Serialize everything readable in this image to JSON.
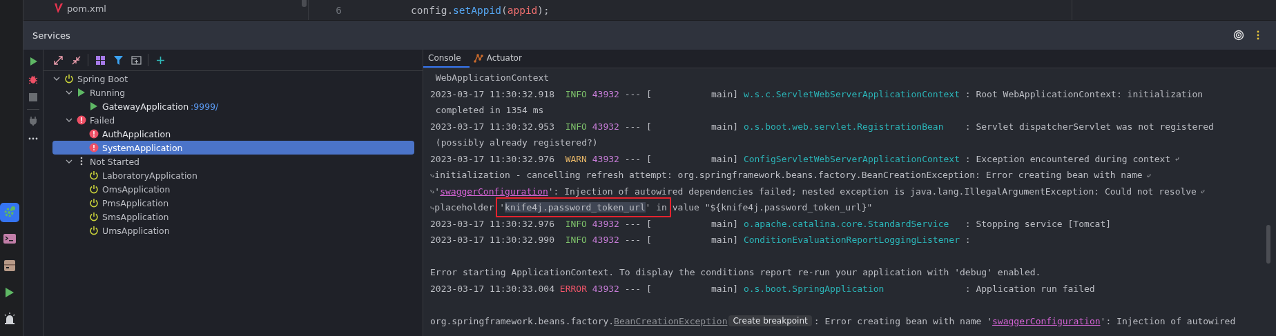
{
  "tool_window_bar": {
    "tools": [
      {
        "selected": true
      },
      {
        "selected": false
      },
      {
        "selected": false
      },
      {
        "selected": false
      },
      {
        "selected": false
      }
    ]
  },
  "project_tree": {
    "items": [
      {
        "label": "pom.xml"
      }
    ]
  },
  "editor": {
    "lines": [
      {
        "number": "6",
        "tokens": [
          {
            "text": "config.",
            "kind": "plain"
          },
          {
            "text": "setAppid",
            "kind": "method"
          },
          {
            "text": "(",
            "kind": "plain"
          },
          {
            "text": "appid",
            "kind": "param"
          },
          {
            "text": ");",
            "kind": "plain"
          }
        ]
      }
    ]
  },
  "services": {
    "title": "Services",
    "tree": [
      {
        "label": "Spring Boot",
        "kind": "root",
        "expanded": true,
        "selected": false,
        "children": [
          {
            "label": "Running",
            "kind": "running",
            "expanded": true,
            "selected": false,
            "children": [
              {
                "label": "GatewayApplication",
                "port": ":9999/",
                "kind": "app-running",
                "selected": false
              }
            ]
          },
          {
            "label": "Failed",
            "kind": "failed",
            "expanded": true,
            "selected": false,
            "children": [
              {
                "label": "AuthApplication",
                "kind": "app-failed",
                "selected": false
              },
              {
                "label": "SystemApplication",
                "kind": "app-failed",
                "selected": true
              }
            ]
          },
          {
            "label": "Not Started",
            "kind": "not-started",
            "expanded": true,
            "selected": false,
            "children": [
              {
                "label": "LaboratoryApplication",
                "kind": "app-idle",
                "selected": false
              },
              {
                "label": "OmsApplication",
                "kind": "app-idle",
                "selected": false
              },
              {
                "label": "PmsApplication",
                "kind": "app-idle",
                "selected": false
              },
              {
                "label": "SmsApplication",
                "kind": "app-idle",
                "selected": false
              },
              {
                "label": "UmsApplication",
                "kind": "app-idle",
                "selected": false
              }
            ]
          }
        ]
      }
    ],
    "tabs": [
      {
        "label": "Console",
        "selected": true
      },
      {
        "label": "Actuator",
        "selected": false
      }
    ],
    "console": {
      "lines": [
        {
          "kind": "text",
          "indent": true,
          "segments": [
            {
              "text": "WebApplicationContext",
              "kind": "plain"
            }
          ]
        },
        {
          "kind": "log",
          "timestamp": "2023-03-17 11:30:32.918",
          "level": "INFO",
          "pid": "43932",
          "separator": "---",
          "thread": "[           main]",
          "logger": "w.s.c.ServletWebServerApplicationContext",
          "message": ": Root WebApplicationContext: initialization"
        },
        {
          "kind": "text",
          "indent": true,
          "segments": [
            {
              "text": "completed in 1354 ms",
              "kind": "plain"
            }
          ]
        },
        {
          "kind": "log",
          "timestamp": "2023-03-17 11:30:32.953",
          "level": "INFO",
          "pid": "43932",
          "separator": "---",
          "thread": "[           main]",
          "logger": "o.s.boot.web.servlet.RegistrationBean",
          "message": ": Servlet dispatcherServlet was not registered"
        },
        {
          "kind": "text",
          "indent": true,
          "segments": [
            {
              "text": "(possibly already registered?)",
              "kind": "plain"
            }
          ]
        },
        {
          "kind": "log",
          "timestamp": "2023-03-17 11:30:32.976",
          "level": "WARN",
          "pid": "43932",
          "separator": "---",
          "thread": "[           main]",
          "logger": "ConfigServletWebServerApplicationContext",
          "message": ": Exception encountered during context",
          "wrap_mark": "⤶"
        },
        {
          "kind": "text",
          "segments": [
            {
              "text": "⤷",
              "kind": "wrap-mark"
            },
            {
              "text": "initialization - cancelling refresh attempt: org.springframework.beans.factory.BeanCreationException: Error creating bean with name",
              "kind": "plain"
            },
            {
              "text": "⤶",
              "kind": "wrap-mark"
            }
          ]
        },
        {
          "kind": "text",
          "segments": [
            {
              "text": "⤷",
              "kind": "wrap-mark"
            },
            {
              "text": "'",
              "kind": "plain"
            },
            {
              "text": "swaggerConfiguration",
              "kind": "link"
            },
            {
              "text": "': Injection of autowired dependencies failed; nested exception is java.lang.IllegalArgumentException: Could not resolve",
              "kind": "plain"
            },
            {
              "text": "⤶",
              "kind": "wrap-mark"
            }
          ]
        },
        {
          "kind": "text",
          "segments": [
            {
              "text": "⤷",
              "kind": "wrap-mark"
            },
            {
              "text": "placeholder '",
              "kind": "plain"
            },
            {
              "text": "knife4j.password_token_url",
              "kind": "selected",
              "boxed": true
            },
            {
              "text": "' in value \"${knife4j.password_token_url}\"",
              "kind": "plain"
            }
          ]
        },
        {
          "kind": "log",
          "timestamp": "2023-03-17 11:30:32.976",
          "level": "INFO",
          "pid": "43932",
          "separator": "---",
          "thread": "[           main]",
          "logger": "o.apache.catalina.core.StandardService",
          "message": ": Stopping service [Tomcat]"
        },
        {
          "kind": "log",
          "timestamp": "2023-03-17 11:30:32.990",
          "level": "INFO",
          "pid": "43932",
          "separator": "---",
          "thread": "[           main]",
          "logger": "ConditionEvaluationReportLoggingListener",
          "message": ":"
        },
        {
          "kind": "blank"
        },
        {
          "kind": "text",
          "indent": false,
          "segments": [
            {
              "text": "Error starting ApplicationContext. To display the conditions report re-run your application with 'debug' enabled.",
              "kind": "plain"
            }
          ]
        },
        {
          "kind": "log",
          "timestamp": "2023-03-17 11:30:33.004",
          "level": "ERROR",
          "pid": "43932",
          "separator": "---",
          "thread": "[           main]",
          "logger": "o.s.boot.SpringApplication",
          "message": ": Application run failed"
        },
        {
          "kind": "blank"
        },
        {
          "kind": "text",
          "indent": false,
          "segments": [
            {
              "text": "org.springframework.beans.factory.",
              "kind": "plain"
            },
            {
              "text": "BeanCreationException",
              "kind": "class-link"
            },
            {
              "text": "Create breakpoint",
              "kind": "hint-button"
            },
            {
              "text": ": Error creating bean with name '",
              "kind": "plain"
            },
            {
              "text": "swaggerConfiguration",
              "kind": "link"
            },
            {
              "text": "': Injection of autowired",
              "kind": "plain"
            }
          ]
        }
      ]
    }
  }
}
